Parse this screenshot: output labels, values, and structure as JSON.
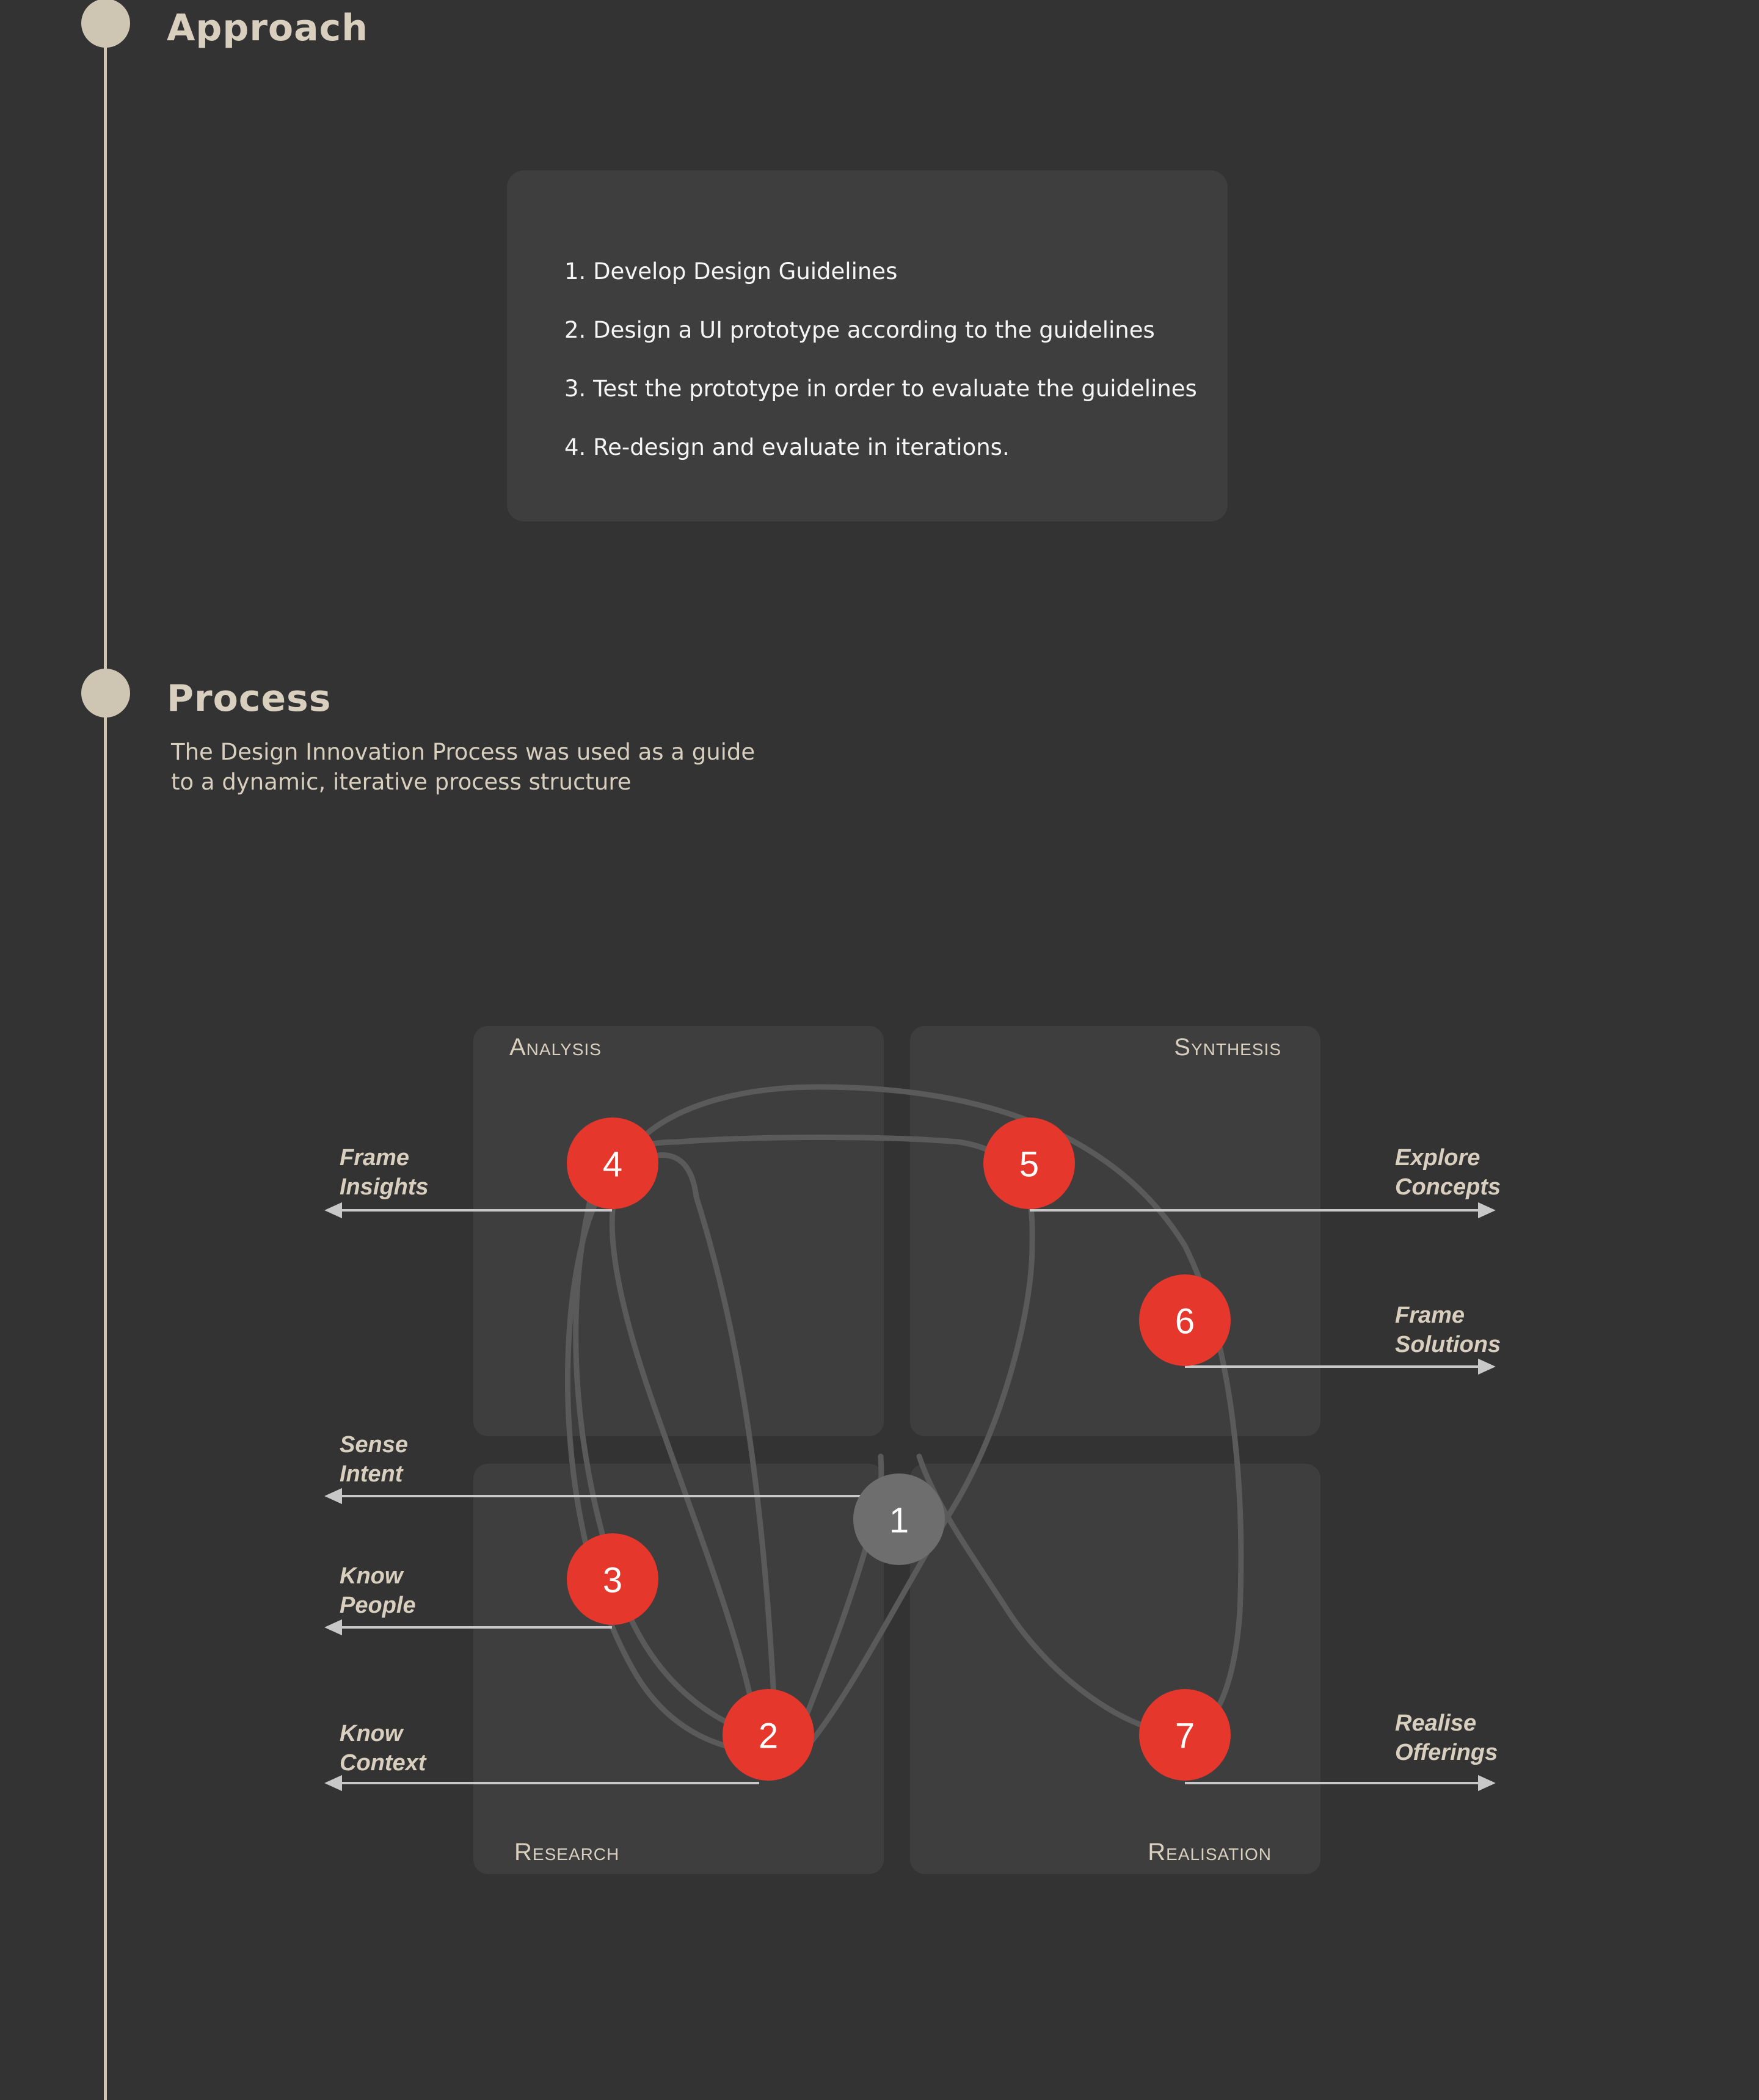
{
  "colors": {
    "background": "#333333",
    "card": "#3e3e3e",
    "timeline": "#cfc5b3",
    "title": "#d8cfbf",
    "accent_red": "#e5372b",
    "node_gray": "#6e6e6e",
    "loop_stroke": "#5a5a5a",
    "connector": "#c8c8c8"
  },
  "approach": {
    "title": "Approach",
    "steps": [
      "1. Develop Design Guidelines",
      "2. Design a UI prototype according to the guidelines",
      "3. Test the prototype in order to evaluate the guidelines",
      "4. Re-design and evaluate in iterations."
    ]
  },
  "process": {
    "title": "Process",
    "description_lines": [
      "The Design Innovation Process was used as a guide",
      "to a dynamic, iterative process structure"
    ]
  },
  "diagram": {
    "quadrants": {
      "analysis": "Analysis",
      "synthesis": "Synthesis",
      "research": "Research",
      "realisation": "Realisation"
    },
    "nodes": [
      "1",
      "2",
      "3",
      "4",
      "5",
      "6",
      "7"
    ],
    "labels": {
      "frame_insights": [
        "Frame",
        "Insights"
      ],
      "sense_intent": [
        "Sense",
        "Intent"
      ],
      "know_people": [
        "Know",
        "People"
      ],
      "know_context": [
        "Know",
        "Context"
      ],
      "explore_concepts": [
        "Explore",
        "Concepts"
      ],
      "frame_solutions": [
        "Frame",
        "Solutions"
      ],
      "realise_offerings": [
        "Realise",
        "Offerings"
      ]
    }
  }
}
